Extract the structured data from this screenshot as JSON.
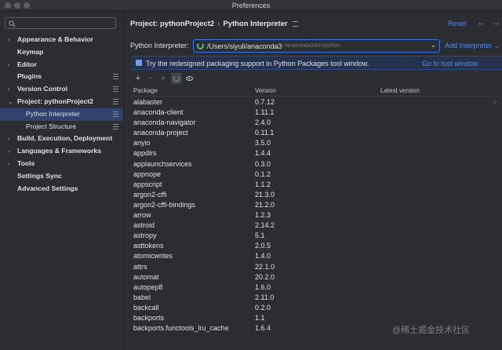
{
  "window": {
    "title": "Preferences"
  },
  "sidebar": {
    "items": [
      {
        "label": "Appearance & Behavior",
        "arrow": "›",
        "child": false,
        "selected": false
      },
      {
        "label": "Keymap",
        "arrow": "",
        "child": false,
        "selected": false
      },
      {
        "label": "Editor",
        "arrow": "›",
        "child": false,
        "selected": false
      },
      {
        "label": "Plugins",
        "arrow": "",
        "child": false,
        "selected": false,
        "icon": "list-icon"
      },
      {
        "label": "Version Control",
        "arrow": "›",
        "child": false,
        "selected": false,
        "icon": "list-icon"
      },
      {
        "label": "Project: pythonProject2",
        "arrow": "⌄",
        "child": false,
        "selected": false,
        "icon": "list-icon"
      },
      {
        "label": "Python Interpreter",
        "arrow": "",
        "child": true,
        "selected": true,
        "icon": "list-icon"
      },
      {
        "label": "Project Structure",
        "arrow": "",
        "child": true,
        "selected": false,
        "icon": "list-icon"
      },
      {
        "label": "Build, Execution, Deployment",
        "arrow": "›",
        "child": false,
        "selected": false
      },
      {
        "label": "Languages & Frameworks",
        "arrow": "›",
        "child": false,
        "selected": false
      },
      {
        "label": "Tools",
        "arrow": "›",
        "child": false,
        "selected": false
      },
      {
        "label": "Settings Sync",
        "arrow": "",
        "child": false,
        "selected": false
      },
      {
        "label": "Advanced Settings",
        "arrow": "",
        "child": false,
        "selected": false
      }
    ]
  },
  "header": {
    "project": "Project: pythonProject2",
    "separator": "›",
    "page": "Python Interpreter",
    "reset_label": "Reset"
  },
  "interpreter": {
    "label": "Python Interpreter:",
    "path": "/Users/siyuli/anaconda3",
    "sub_path": "~/anaconda3/bin/python",
    "add_label": "Add Interpreter ⌄"
  },
  "banner": {
    "text": "Try the redesigned packaging support in Python Packages tool window.",
    "link": "Go to tool window"
  },
  "table": {
    "columns": [
      "Package",
      "Version",
      "Latest version"
    ],
    "rows": [
      {
        "pkg": "alabaster",
        "ver": "0.7.12",
        "latest": ""
      },
      {
        "pkg": "anaconda-client",
        "ver": "1.11.1",
        "latest": ""
      },
      {
        "pkg": "anaconda-navigator",
        "ver": "2.4.0",
        "latest": ""
      },
      {
        "pkg": "anaconda-project",
        "ver": "0.11.1",
        "latest": ""
      },
      {
        "pkg": "anyio",
        "ver": "3.5.0",
        "latest": ""
      },
      {
        "pkg": "appdirs",
        "ver": "1.4.4",
        "latest": ""
      },
      {
        "pkg": "applaunchservices",
        "ver": "0.3.0",
        "latest": ""
      },
      {
        "pkg": "appnope",
        "ver": "0.1.2",
        "latest": ""
      },
      {
        "pkg": "appscript",
        "ver": "1.1.2",
        "latest": ""
      },
      {
        "pkg": "argon2-cffi",
        "ver": "21.3.0",
        "latest": ""
      },
      {
        "pkg": "argon2-cffi-bindings",
        "ver": "21.2.0",
        "latest": ""
      },
      {
        "pkg": "arrow",
        "ver": "1.2.3",
        "latest": ""
      },
      {
        "pkg": "astroid",
        "ver": "2.14.2",
        "latest": ""
      },
      {
        "pkg": "astropy",
        "ver": "5.1",
        "latest": ""
      },
      {
        "pkg": "asttokens",
        "ver": "2.0.5",
        "latest": ""
      },
      {
        "pkg": "atomicwrites",
        "ver": "1.4.0",
        "latest": ""
      },
      {
        "pkg": "attrs",
        "ver": "22.1.0",
        "latest": ""
      },
      {
        "pkg": "automat",
        "ver": "20.2.0",
        "latest": ""
      },
      {
        "pkg": "autopep8",
        "ver": "1.6.0",
        "latest": ""
      },
      {
        "pkg": "babel",
        "ver": "2.11.0",
        "latest": ""
      },
      {
        "pkg": "backcall",
        "ver": "0.2.0",
        "latest": ""
      },
      {
        "pkg": "backports",
        "ver": "1.1",
        "latest": ""
      },
      {
        "pkg": "backports.functools_lru_cache",
        "ver": "1.6.4",
        "latest": ""
      }
    ]
  },
  "toolbar": {
    "add": "+",
    "remove": "−",
    "upgrade": "▲"
  },
  "watermark": "@稀土掘金技术社区",
  "colors": {
    "accent": "#3574f0",
    "link": "#548af7",
    "selection": "#2e436e",
    "background": "#2b2d30"
  }
}
